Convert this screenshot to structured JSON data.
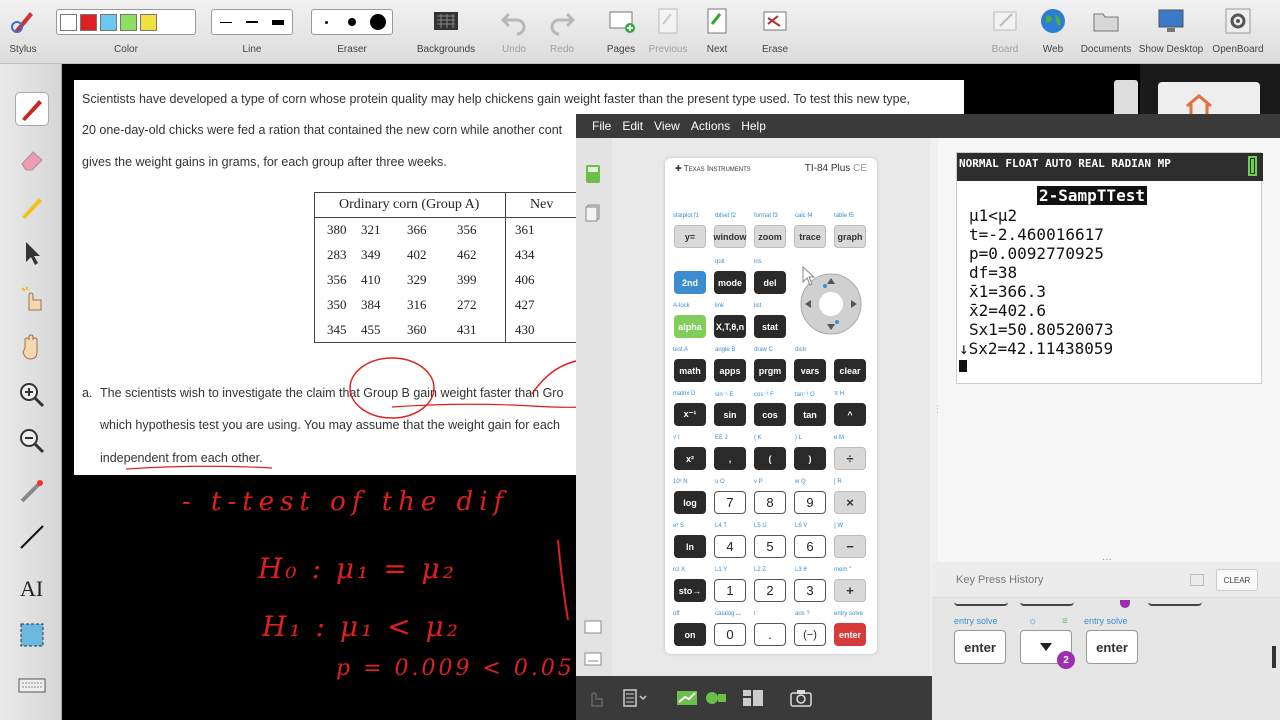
{
  "toolbar": {
    "stylus": "Stylus",
    "color": "Color",
    "line": "Line",
    "eraser": "Eraser",
    "backgrounds": "Backgrounds",
    "undo": "Undo",
    "redo": "Redo",
    "pages": "Pages",
    "previous": "Previous",
    "next": "Next",
    "erase": "Erase",
    "board": "Board",
    "web": "Web",
    "documents": "Documents",
    "show_desktop": "Show Desktop",
    "openboard": "OpenBoard",
    "palette": [
      "#ffffff",
      "#e02020",
      "#6cc8f0",
      "#8ee060",
      "#f0e040"
    ]
  },
  "doc": {
    "line1": "Scientists have developed a type of corn whose protein quality may help chickens gain weight faster than the present type used. To test this new type,",
    "line2": "20 one-day-old chicks were fed a ration that contained the new corn while another cont",
    "line3": "gives the weight gains in grams, for each group after three weeks.",
    "table_head_a": "Ordinary corn (Group A)",
    "table_head_b": "Nev",
    "rows": [
      [
        "380",
        "321",
        "366",
        "356",
        "361"
      ],
      [
        "283",
        "349",
        "402",
        "462",
        "434"
      ],
      [
        "356",
        "410",
        "329",
        "399",
        "406"
      ],
      [
        "350",
        "384",
        "316",
        "272",
        "427"
      ],
      [
        "345",
        "455",
        "360",
        "431",
        "430"
      ]
    ],
    "qa_label": "a.",
    "qa1": "The scientists wish to investigate the claim that Group B gain weight faster than Gro",
    "qa2": "which hypothesis test you are using. You may assume that the weight gain for each",
    "qa3": "independent from each other."
  },
  "handwriting": {
    "h1": "- t-test   of the dif",
    "h2": "H₀ :  μ₁ = μ₂",
    "h3": "H₁ :  μ₁ < μ₂",
    "h4": "p = 0.009 < 0.05"
  },
  "emulator": {
    "menu": [
      "File",
      "Edit",
      "View",
      "Actions",
      "Help"
    ],
    "brand": "Texas Instruments",
    "model": "TI-84 Plus",
    "model_suffix": "CE",
    "screen_header": "NORMAL FLOAT AUTO REAL RADIAN MP",
    "screen_title": "2-SampTTest",
    "screen_lines": [
      "μ1<μ2",
      "t=-2.460016617",
      "p=0.0092770925",
      "df=38",
      "x̄1=366.3",
      "x̄2=402.6",
      "Sx1=50.80520073",
      "↓Sx2=42.11438059"
    ],
    "key_press_history": "Key Press History",
    "clear": "CLEAR",
    "history_keys": [
      "enter",
      "enter"
    ],
    "history_badge": "2",
    "entry_solve": "entry solve",
    "keys": {
      "r1": [
        "y=",
        "window",
        "zoom",
        "trace",
        "graph"
      ],
      "r2": [
        "2nd",
        "mode",
        "del"
      ],
      "r3": [
        "alpha",
        "X,T,θ,n",
        "stat"
      ],
      "r4": [
        "math",
        "apps",
        "prgm",
        "vars",
        "clear"
      ],
      "r5": [
        "x⁻¹",
        "sin",
        "cos",
        "tan",
        "^"
      ],
      "r6": [
        "x²",
        ",",
        "(",
        ")",
        "÷"
      ],
      "r7": [
        "log",
        "7",
        "8",
        "9",
        "×"
      ],
      "r8": [
        "ln",
        "4",
        "5",
        "6",
        "−"
      ],
      "r9": [
        "sto→",
        "1",
        "2",
        "3",
        "+"
      ],
      "r10": [
        "on",
        "0",
        ".",
        "(−)",
        "enter"
      ]
    },
    "subs": {
      "r1": [
        "statplot f1",
        "tblset f2",
        "format f3",
        "calc f4",
        "table f5"
      ],
      "r2": [
        "quit",
        "ins"
      ],
      "r3": [
        "A-lock",
        "link",
        "list"
      ],
      "r4": [
        "test A",
        "angle B",
        "draw C",
        "distr"
      ],
      "r5": [
        "matrix D",
        "sin⁻¹ E",
        "cos⁻¹ F",
        "tan⁻¹ G",
        "π H"
      ],
      "r6": [
        "√ I",
        "EE J",
        "{ K",
        "} L",
        "e M"
      ],
      "r7": [
        "10ˣ N",
        "u O",
        "v P",
        "w Q",
        "[ R"
      ],
      "r8": [
        "eˣ S",
        "L4 T",
        "L5 U",
        "L6 V",
        "] W"
      ],
      "r9": [
        "rcl X",
        "L1 Y",
        "L2 Z",
        "L3 θ",
        "mem \""
      ],
      "r10": [
        "off",
        "catalog ⌴",
        "i :",
        "ans ?",
        "entry solve"
      ]
    }
  }
}
